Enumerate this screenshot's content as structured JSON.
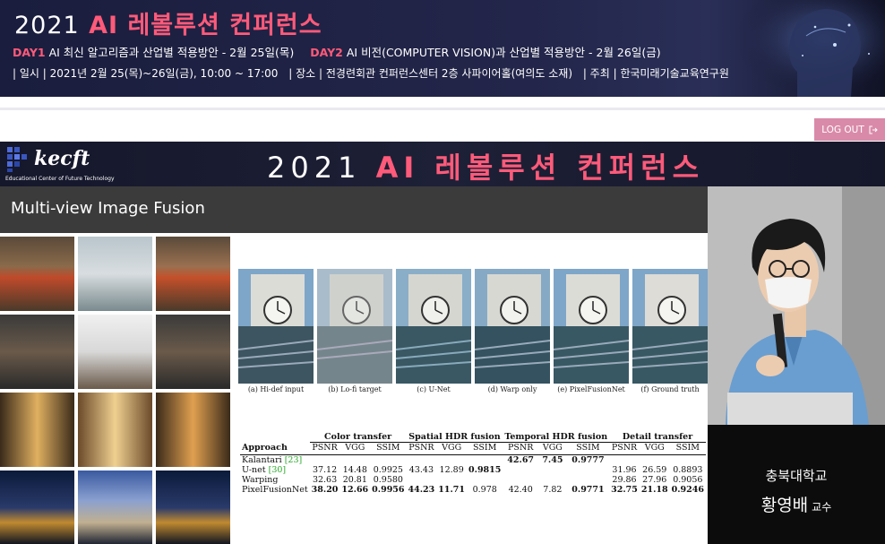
{
  "banner": {
    "year": "2021",
    "title": "AI 레볼루션 컨퍼런스",
    "day1_tag": "DAY1",
    "day1_text": "AI 최신 알고리즘과 산업별 적용방안 - 2월 25일(목)",
    "day2_tag": "DAY2",
    "day2_text": "AI 비전(COMPUTER VISION)과 산업별 적용방안 - 2월 26일(금)",
    "info": [
      "| 일시 | 2021년 2월 25(목)~26일(금), 10:00 ~ 17:00",
      "| 장소 | 전경련회관 컨퍼런스센터 2층 사파이어홀(여의도 소재)",
      "| 주최 | 한국미래기술교육연구원"
    ]
  },
  "logout_label": "LOG OUT",
  "video": {
    "logo_text": "kecft",
    "logo_sub": "Educational Center of Future Technology",
    "header_year": "2021",
    "header_title": "AI 레볼루션 컨퍼런스",
    "slide_title": "Multi-view Image Fusion",
    "figure_captions": [
      "(a) Hi-def input",
      "(b) Lo-fi target",
      "(c) U-Net",
      "(d) Warp only",
      "(e) PixelFusionNet",
      "(f) Ground truth"
    ],
    "table": {
      "approach_label": "Approach",
      "groups": [
        "Color transfer",
        "Spatial HDR fusion",
        "Temporal HDR fusion",
        "Detail transfer"
      ],
      "metrics": [
        "PSNR",
        "VGG",
        "SSIM"
      ],
      "rows": [
        {
          "name": "Kalantari",
          "cite": "[23]",
          "cells": [
            "",
            "",
            "",
            "",
            "",
            "",
            "42.67",
            "7.45",
            "0.9777",
            "",
            "",
            ""
          ]
        },
        {
          "name": "U-net",
          "cite": "[30]",
          "cells": [
            "37.12",
            "14.48",
            "0.9925",
            "43.43",
            "12.89",
            "0.9815",
            "",
            "",
            "",
            "31.96",
            "26.59",
            "0.8893"
          ]
        },
        {
          "name": "Warping",
          "cite": "",
          "cells": [
            "32.63",
            "20.81",
            "0.9580",
            "",
            "",
            "",
            "",
            "",
            "",
            "29.86",
            "27.96",
            "0.9056"
          ]
        },
        {
          "name": "PixelFusionNet",
          "cite": "",
          "cells": [
            "38.20",
            "12.66",
            "0.9956",
            "44.23",
            "11.71",
            "0.978",
            "42.40",
            "7.82",
            "0.9771",
            "32.75",
            "21.18",
            "0.9246"
          ]
        }
      ],
      "bold": [
        [
          false,
          false,
          false,
          false,
          false,
          false,
          true,
          true,
          true,
          false,
          false,
          false
        ],
        [
          false,
          false,
          false,
          false,
          false,
          true,
          false,
          false,
          false,
          false,
          false,
          false
        ],
        [
          false,
          false,
          false,
          false,
          false,
          false,
          false,
          false,
          false,
          false,
          false,
          false
        ],
        [
          true,
          true,
          true,
          true,
          true,
          false,
          false,
          false,
          true,
          true,
          true,
          true
        ]
      ]
    },
    "speaker_school": "충북대학교",
    "speaker_name": "황영배",
    "speaker_role": "교수"
  },
  "colors": {
    "accent": "#ff5a7a",
    "logout": "#d98aa8",
    "banner_bg": "#1a1d3d"
  }
}
